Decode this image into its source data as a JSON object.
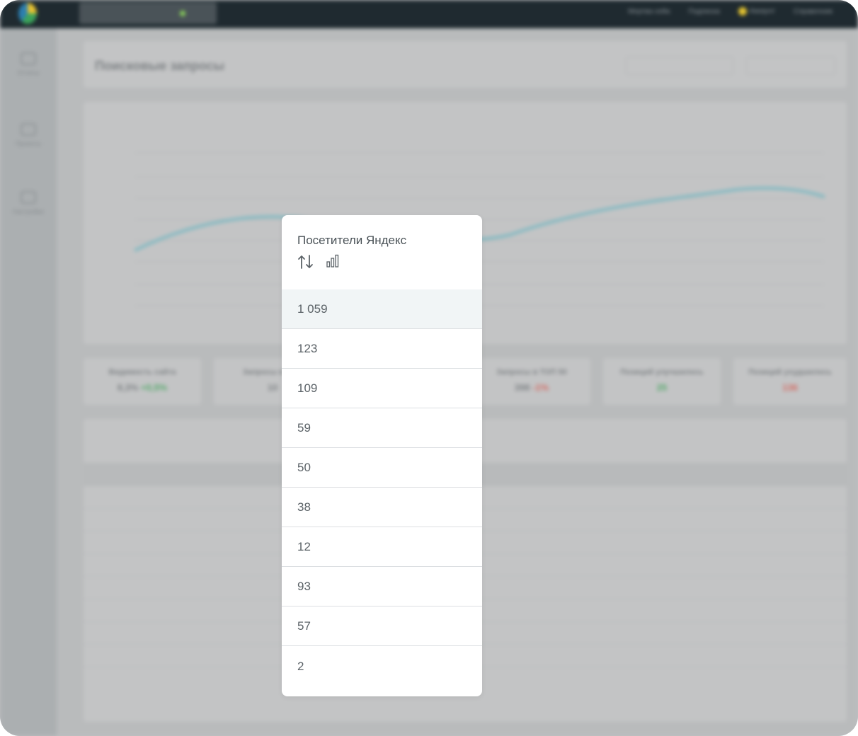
{
  "popup": {
    "title": "Посетители Яндекс",
    "sort_icon": "sort-arrows-icon",
    "chart_icon": "bar-chart-icon",
    "values": [
      "1 059",
      "123",
      "109",
      "59",
      "50",
      "38",
      "12",
      "93",
      "57",
      "2"
    ]
  },
  "background": {
    "page_title": "Поисковые запросы",
    "nav": [
      "Мертва сейа",
      "Подписка",
      "Аккаунт",
      "Справочник"
    ],
    "sidebar": [
      "Отчеты",
      "Проекты",
      "Настройки"
    ],
    "stats": [
      {
        "label": "Видимость сайта",
        "value": "8,3%",
        "delta": "+0,5%"
      },
      {
        "label": "Запросы в ТОП",
        "value": "10",
        "delta": ""
      },
      {
        "label": "",
        "value": "",
        "delta": ""
      },
      {
        "label": "Запросы в ТОП 50",
        "value": "398",
        "delta": "-1%"
      },
      {
        "label": "Позиций улучшилось",
        "value": "25",
        "delta": ""
      },
      {
        "label": "Позиций ухудшилось",
        "value": "136",
        "delta": ""
      }
    ]
  },
  "colors": {
    "popup_bg": "#ffffff",
    "highlight_row": "#f1f5f6",
    "text": "#5b6267",
    "line": "#7fb9c2"
  }
}
